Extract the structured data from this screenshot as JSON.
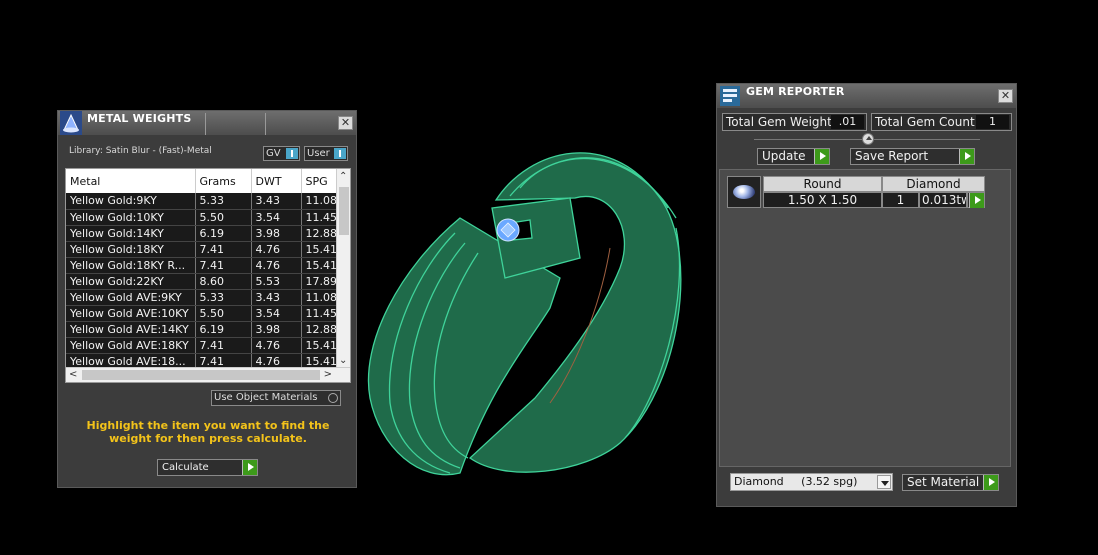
{
  "metal_weights": {
    "title": "METAL WEIGHTS",
    "library": "Library: Satin Blur - (Fast)-Metal",
    "toggle_gv": "GV",
    "toggle_user": "User",
    "columns": [
      "Metal",
      "Grams",
      "DWT",
      "SPG"
    ],
    "rows": [
      [
        "Yellow Gold:9KY",
        "5.33",
        "3.43",
        "11.08"
      ],
      [
        "Yellow Gold:10KY",
        "5.50",
        "3.54",
        "11.45"
      ],
      [
        "Yellow Gold:14KY",
        "6.19",
        "3.98",
        "12.88"
      ],
      [
        "Yellow Gold:18KY",
        "7.41",
        "4.76",
        "15.41"
      ],
      [
        "Yellow Gold:18KY R...",
        "7.41",
        "4.76",
        "15.41"
      ],
      [
        "Yellow Gold:22KY",
        "8.60",
        "5.53",
        "17.89"
      ],
      [
        "Yellow Gold AVE:9KY",
        "5.33",
        "3.43",
        "11.08"
      ],
      [
        "Yellow Gold AVE:10KY",
        "5.50",
        "3.54",
        "11.45"
      ],
      [
        "Yellow Gold AVE:14KY",
        "6.19",
        "3.98",
        "12.88"
      ],
      [
        "Yellow Gold AVE:18KY",
        "7.41",
        "4.76",
        "15.41"
      ],
      [
        "Yellow Gold AVE:18...",
        "7.41",
        "4.76",
        "15.41"
      ]
    ],
    "use_object_materials": "Use Object Materials",
    "hint": "Highlight the item you want to find the weight for then press calculate.",
    "calculate": "Calculate"
  },
  "gem_reporter": {
    "title": "GEM REPORTER",
    "total_gem_weight_label": "Total Gem Weight",
    "total_gem_weight_value": ".01",
    "total_gem_count_label": "Total Gem Count",
    "total_gem_count_value": "1",
    "update": "Update",
    "save_report": "Save Report",
    "gem_row": {
      "shape": "Round",
      "material": "Diamond",
      "size": "1.50 X 1.50",
      "count": "1",
      "weight": "0.013tw"
    },
    "material_select": "Diamond     (3.52 spg)",
    "set_material": "Set Material"
  },
  "colors": {
    "ring_green": "#1f6b4a",
    "ring_edge": "#3fd39a",
    "gem_blue": "#6aa8ff",
    "hint_yellow": "#f3c31a",
    "go_green": "#3d9a1a"
  }
}
